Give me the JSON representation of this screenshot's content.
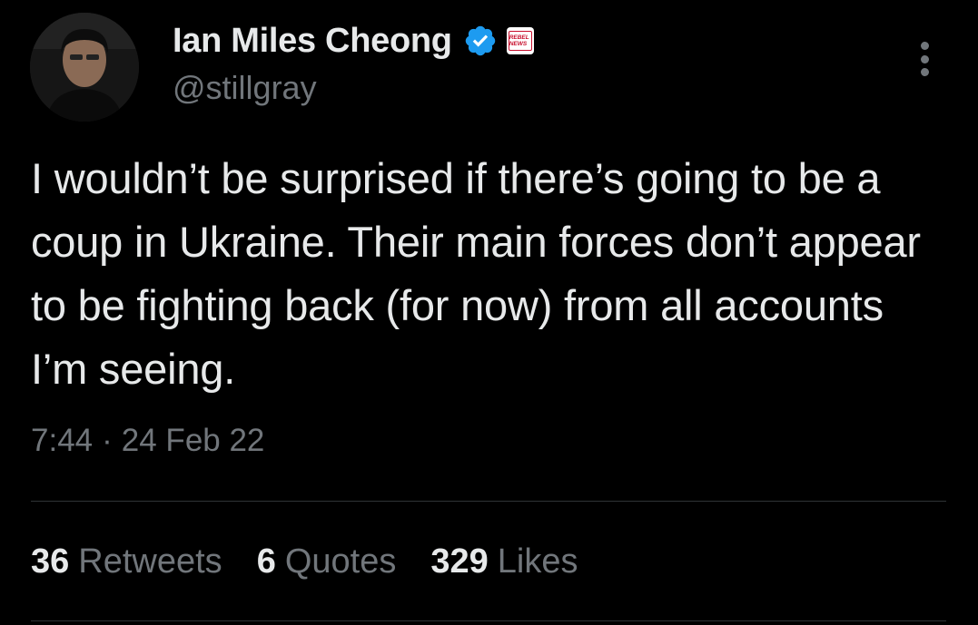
{
  "author": {
    "display_name": "Ian Miles Cheong",
    "handle": "@stillgray",
    "verified": true,
    "affiliation_badge_text": "REBEL NEWS"
  },
  "tweet": {
    "text": "I wouldn’t be surprised if there’s going to be a coup in Ukraine. Their main forces don’t appear to be fighting back (for now) from all accounts I’m seeing.",
    "time": "7:44",
    "separator": "·",
    "date": "24 Feb 22"
  },
  "stats": {
    "retweets_count": "36",
    "retweets_label": "Retweets",
    "quotes_count": "6",
    "quotes_label": "Quotes",
    "likes_count": "329",
    "likes_label": "Likes"
  },
  "icons": {
    "verified": "verified-badge-icon",
    "more": "more-options-icon"
  },
  "colors": {
    "background": "#000000",
    "primary_text": "#e7e9ea",
    "secondary_text": "#71767b",
    "verified_blue": "#1d9bf0",
    "divider": "#2f3336"
  }
}
